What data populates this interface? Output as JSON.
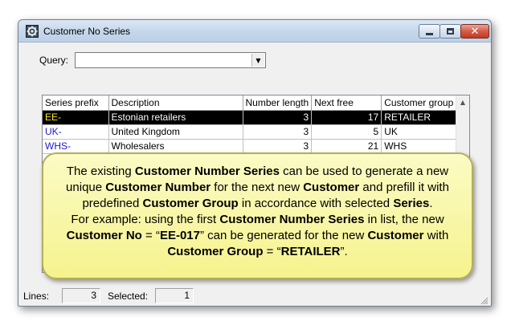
{
  "window": {
    "title": "Customer No Series",
    "icons": {
      "app": "gear-icon",
      "minimize": "minimize-icon",
      "maximize": "maximize-icon",
      "close": "close-icon"
    }
  },
  "query": {
    "label": "Query:",
    "value": ""
  },
  "table": {
    "columns": [
      "Series prefix",
      "Description",
      "Number length",
      "Next free",
      "Customer group"
    ],
    "rows": [
      {
        "prefix": "EE-",
        "description": "Estonian retailers",
        "length": "3",
        "next": "17",
        "group": "RETAILER"
      },
      {
        "prefix": "UK-",
        "description": "United Kingdom",
        "length": "3",
        "next": "5",
        "group": "UK"
      },
      {
        "prefix": "WHS-",
        "description": "Wholesalers",
        "length": "3",
        "next": "21",
        "group": "WHS"
      }
    ],
    "selected_row": 0
  },
  "callout": {
    "l1a": "The existing ",
    "l1b": "Customer Number Series",
    "l1c": " can be used to generate a new",
    "l2a": "unique ",
    "l2b": "Customer Number",
    "l2c": " for the next new ",
    "l2d": "Customer",
    "l2e": " and prefill it with",
    "l3a": "predefined ",
    "l3b": "Customer Group",
    "l3c": " in accordance with selected ",
    "l3d": "Series",
    "l3e": ".",
    "l4a": "For example: using the first ",
    "l4b": "Customer Number Series",
    "l4c": " in list, the new",
    "l5a": "Customer No",
    "l5b": " = “",
    "l5c": "EE-017",
    "l5d": "” can be generated for the new ",
    "l5e": "Customer",
    "l5f": " with",
    "l6a": "Customer Group",
    "l6b": " = “",
    "l6c": "RETAILER",
    "l6d": "”."
  },
  "status": {
    "lines_label": "Lines:",
    "lines_value": "3",
    "selected_label": "Selected:",
    "selected_value": "1"
  },
  "colors": {
    "selected_bg": "#000000",
    "selected_prefix": "#f6e82a",
    "prefix": "#1a1acc",
    "callout_bg": "#f8f5a6"
  }
}
